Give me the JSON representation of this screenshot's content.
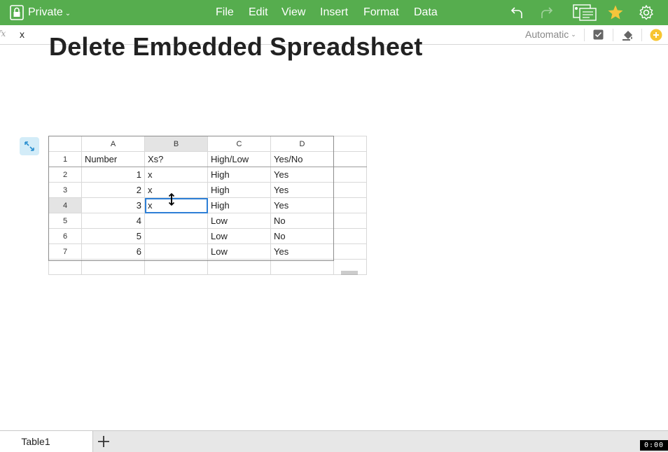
{
  "toolbar": {
    "privacy_label": "Private",
    "menu": [
      "File",
      "Edit",
      "View",
      "Insert",
      "Format",
      "Data"
    ],
    "icons": [
      "lock-icon",
      "undo-icon",
      "redo-icon",
      "present-icon",
      "star-icon",
      "gear-icon"
    ],
    "background": "#56ad4e",
    "star_color": "#f5c53b"
  },
  "formula_bar": {
    "fx_label": "fx",
    "value": "x",
    "format": "Automatic"
  },
  "document": {
    "title": "Delete Embedded Spreadsheet"
  },
  "sheet": {
    "column_headers": [
      "A",
      "B",
      "C",
      "D"
    ],
    "selected_column": "B",
    "selected_row": "4",
    "selected_cell": "B4",
    "rows": [
      {
        "n": "1",
        "cells": [
          "Number",
          "Xs?",
          "High/Low",
          "Yes/No"
        ]
      },
      {
        "n": "2",
        "cells": [
          "1",
          "x",
          "High",
          "Yes"
        ]
      },
      {
        "n": "3",
        "cells": [
          "2",
          "x",
          "High",
          "Yes"
        ]
      },
      {
        "n": "4",
        "cells": [
          "3",
          "x",
          "High",
          "Yes"
        ]
      },
      {
        "n": "5",
        "cells": [
          "4",
          "",
          "Low",
          "No"
        ]
      },
      {
        "n": "6",
        "cells": [
          "5",
          "",
          "Low",
          "No"
        ]
      },
      {
        "n": "7",
        "cells": [
          "6",
          "",
          "Low",
          "Yes"
        ]
      }
    ],
    "selection_color": "#2d7fd6"
  },
  "tabs": {
    "sheets": [
      "Table1"
    ],
    "add_label": "+"
  },
  "clock": "0:00"
}
